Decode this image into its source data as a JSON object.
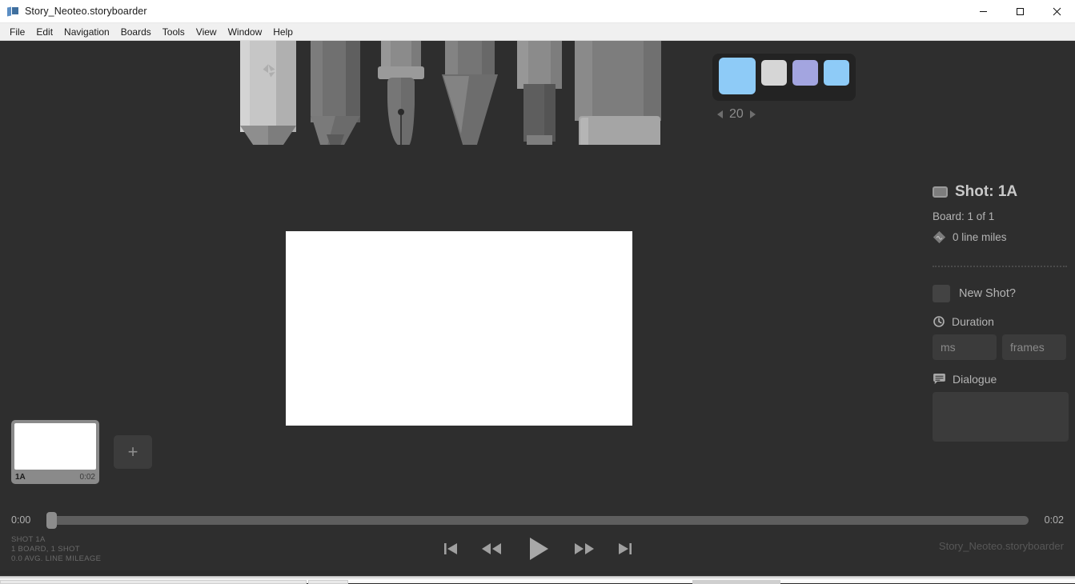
{
  "window": {
    "title": "Story_Neoteo.storyboarder",
    "app_icon": "storyboarder-logo-icon",
    "minimize": "—",
    "maximize": "□",
    "close": "✕"
  },
  "menubar": {
    "items": [
      {
        "label": "File"
      },
      {
        "label": "Edit"
      },
      {
        "label": "Navigation"
      },
      {
        "label": "Boards"
      },
      {
        "label": "Tools"
      },
      {
        "label": "View"
      },
      {
        "label": "Window"
      },
      {
        "label": "Help"
      }
    ]
  },
  "toolbar": {
    "tools": [
      {
        "name": "light-pencil-tool",
        "label": "Light Pencil"
      },
      {
        "name": "pencil-tool",
        "label": "Pencil"
      },
      {
        "name": "pen-tool",
        "label": "Pen"
      },
      {
        "name": "brush-tool",
        "label": "Brush"
      },
      {
        "name": "marker-tool",
        "label": "Note Pen"
      },
      {
        "name": "eraser-tool",
        "label": "Eraser"
      }
    ]
  },
  "palette": {
    "swatches": [
      {
        "name": "swatch-current",
        "color": "#8ecbf7",
        "active": true
      },
      {
        "name": "swatch-1",
        "color": "#d6d6d6",
        "active": false
      },
      {
        "name": "swatch-2",
        "color": "#a3a5e0",
        "active": false
      },
      {
        "name": "swatch-3",
        "color": "#8ecbf7",
        "active": false
      }
    ],
    "size": {
      "value": "20",
      "decrease_icon": "arrow-left-icon",
      "increase_icon": "arrow-right-icon"
    }
  },
  "canvas": {
    "background": "#ffffff"
  },
  "sidebar": {
    "shot_icon": "monitor-icon",
    "shot_title": "Shot: 1A",
    "board_count": "Board: 1 of 1",
    "line_miles_icon": "line-miles-icon",
    "line_miles": "0 line miles",
    "new_shot_label": "New Shot?",
    "duration_icon": "clock-icon",
    "duration_label": "Duration",
    "duration_ms_placeholder": "ms",
    "duration_ms_value": "",
    "duration_frames_placeholder": "frames",
    "duration_frames_value": "",
    "dialogue_icon": "speech-bubble-icon",
    "dialogue_label": "Dialogue",
    "dialogue_value": "",
    "dialogue_placeholder": ""
  },
  "board_strip": {
    "boards": [
      {
        "shot": "1A",
        "duration": "0:02"
      }
    ],
    "add_label": "+"
  },
  "timeline": {
    "start_time": "0:00",
    "end_time": "0:02",
    "playhead_percent": 0,
    "status_lines": [
      "SHOT 1A",
      "1 BOARD, 1 SHOT",
      "0.0 AVG. LINE MILEAGE"
    ],
    "filename": "Story_Neoteo.storyboarder",
    "transport": [
      {
        "name": "skip-previous-button",
        "icon": "skip-previous-icon"
      },
      {
        "name": "rewind-button",
        "icon": "rewind-icon"
      },
      {
        "name": "play-button",
        "icon": "play-icon"
      },
      {
        "name": "fast-forward-button",
        "icon": "fast-forward-icon"
      },
      {
        "name": "skip-next-button",
        "icon": "skip-next-icon"
      }
    ]
  }
}
